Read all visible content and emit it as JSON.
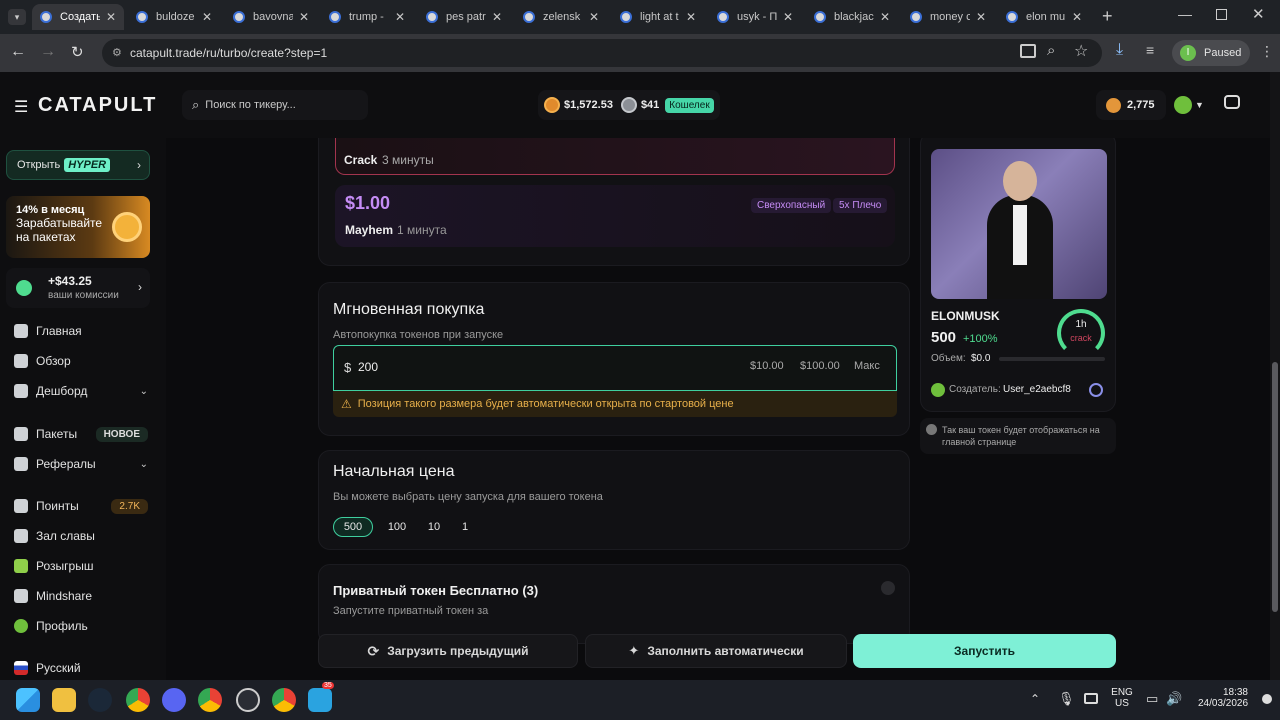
{
  "browser": {
    "tabs": [
      {
        "label": "Создать",
        "active": true
      },
      {
        "label": "buldoze"
      },
      {
        "label": "bavovna"
      },
      {
        "label": "trump -"
      },
      {
        "label": "pes patr"
      },
      {
        "label": "zelensk"
      },
      {
        "label": "light at t"
      },
      {
        "label": "usyk - П"
      },
      {
        "label": "blackjac"
      },
      {
        "label": "money c"
      },
      {
        "label": "elon mu"
      }
    ],
    "url": "catapult.trade/ru/turbo/create?step=1",
    "profile_status": "Paused",
    "profile_initial": "I"
  },
  "header": {
    "logo": "CATAPULT",
    "search_placeholder": "Поиск по тикеру...",
    "balance_token": "$1,572.53",
    "balance_usd": "$41",
    "wallet_label": "Кошелек",
    "points": "2,775"
  },
  "sidebar": {
    "open_label": "Открыть",
    "hyper_badge": "HYPER",
    "promo_line1": "14% в месяц",
    "promo_line2": "Зарабатывайте",
    "promo_line3": "на пакетах",
    "commission_value": "+$43.25",
    "commission_label": "ваши комиссии",
    "items": [
      {
        "label": "Главная"
      },
      {
        "label": "Обзор"
      },
      {
        "label": "Дешборд"
      },
      {
        "label": "Пакеты",
        "badge": "НОВОЕ"
      },
      {
        "label": "Рефералы"
      },
      {
        "label": "Поинты",
        "badge": "2.7K"
      },
      {
        "label": "Зал славы"
      },
      {
        "label": "Розыгрыш"
      },
      {
        "label": "Mindshare"
      },
      {
        "label": "Профиль"
      }
    ],
    "language": "Русский"
  },
  "main": {
    "crack_name": "Crack",
    "crack_duration": "3 минуты",
    "mayhem_price": "$1.00",
    "mayhem_tag1": "Сверхопасный",
    "mayhem_tag2": "5x Плечо",
    "mayhem_name": "Mayhem",
    "mayhem_duration": "1 минута",
    "instant_title": "Мгновенная покупка",
    "instant_subtitle": "Автопокупка токенов при запуске",
    "currency_symbol": "$",
    "amount_value": "200",
    "quick1": "$10.00",
    "quick2": "$100.00",
    "quick_max": "Макс",
    "warning": "Позиция такого размера будет автоматически открыта по стартовой цене",
    "start_price_title": "Начальная цена",
    "start_price_subtitle": "Вы можете выбрать цену запуска для вашего токена",
    "price_options": [
      "500",
      "100",
      "10",
      "1"
    ],
    "private_title": "Приватный токен Бесплатно (3)",
    "private_subtitle": "Запустите приватный токен за"
  },
  "preview": {
    "ticker": "ELONMUSK",
    "price": "500",
    "change": "+100%",
    "timer": "1h",
    "timer_type": "crack",
    "volume_label": "Объем:",
    "volume_value": "$0.0",
    "creator_label": "Создатель:",
    "creator_name": "User_e2aebcf8",
    "note": "Так ваш токен будет отображаться на главной странице"
  },
  "actions": {
    "load_prev": "Загрузить предыдущий",
    "autofill": "Заполнить автоматически",
    "launch": "Запустить"
  },
  "taskbar": {
    "lang1": "ENG",
    "lang2": "US",
    "time": "18:38",
    "date": "24/03/2026",
    "telegram_badge": "35"
  },
  "colors": {
    "accent": "#7ef0d6",
    "crack_border": "#a3344e",
    "mayhem_price": "#c58cf5",
    "warning_text": "#e8b04a",
    "positive": "#4fdc8f"
  }
}
